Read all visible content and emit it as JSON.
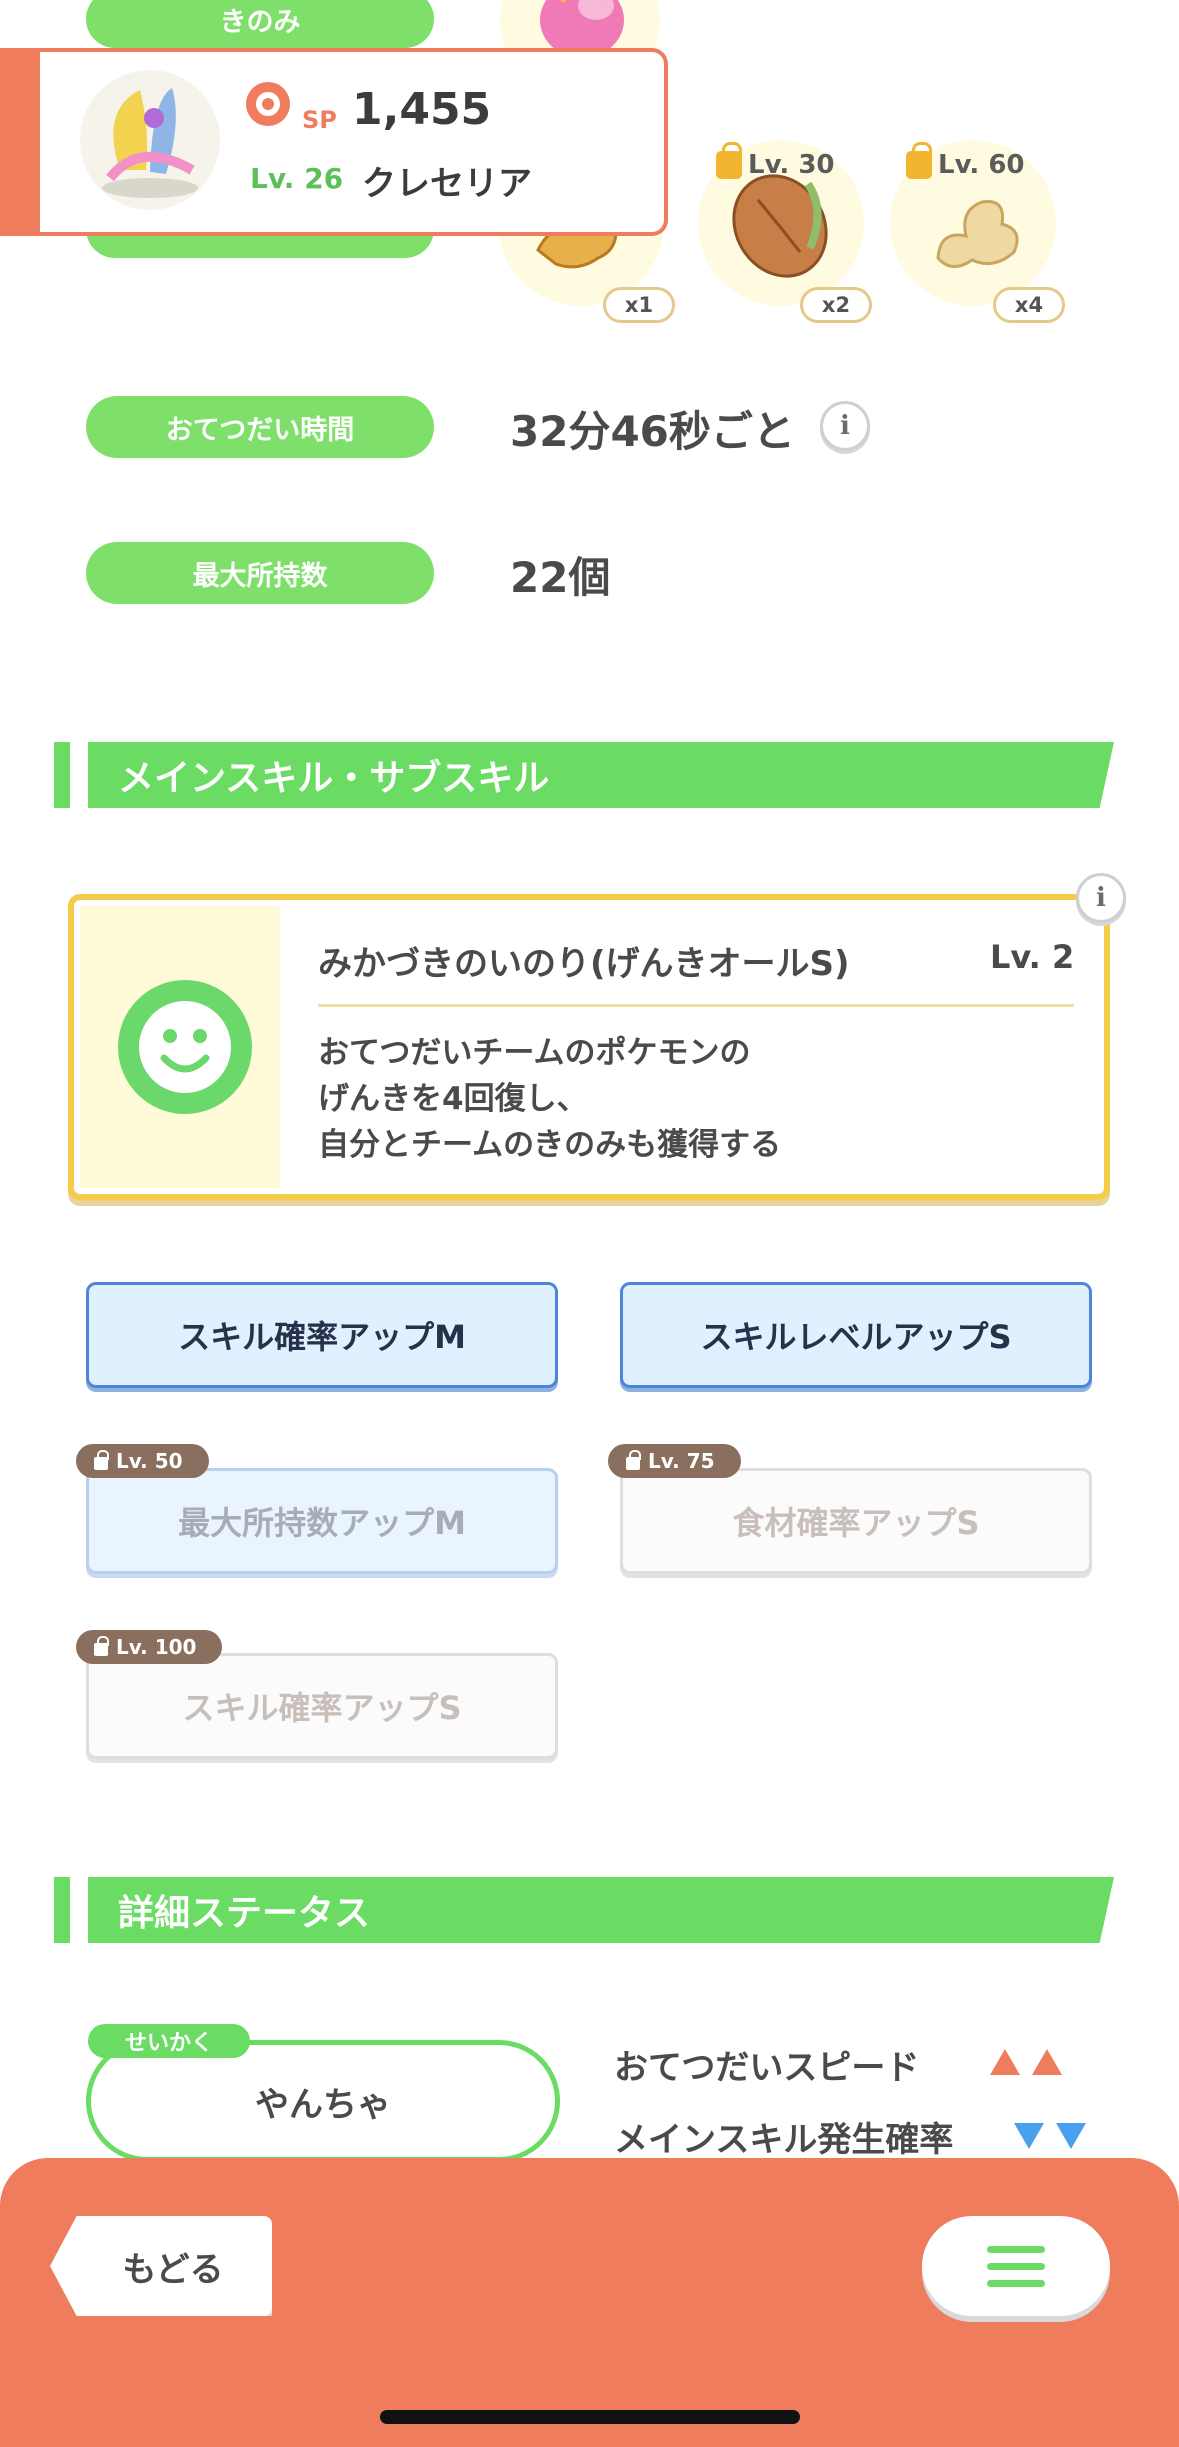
{
  "berry_section": {
    "label": "きのみ"
  },
  "pokemon": {
    "sp_label": "SP",
    "sp_value": "1,455",
    "level": "Lv. 26",
    "name": "クレセリア"
  },
  "ingredients": [
    {
      "name": "ginger-ingredient",
      "count": "x1",
      "unlock": ""
    },
    {
      "name": "cacao-ingredient",
      "count": "x2",
      "unlock": "Lv. 30"
    },
    {
      "name": "ginger-ingredient",
      "count": "x4",
      "unlock": "Lv. 60"
    }
  ],
  "stats": {
    "help_time_label": "おてつだい時間",
    "help_time_value": "32分46秒ごと",
    "max_carry_label": "最大所持数",
    "max_carry_value": "22個"
  },
  "skills_section": {
    "title": "メインスキル・サブスキル",
    "main_skill": {
      "name": "みかづきのいのり(げんきオールS)",
      "level": "Lv. 2",
      "description_lines": [
        "おてつだいチームのポケモンの",
        "げんきを4回復し、",
        "自分とチームのきのみも獲得する"
      ]
    },
    "sub_skills": [
      {
        "label": "スキル確率アップM",
        "unlock": ""
      },
      {
        "label": "スキルレベルアップS",
        "unlock": ""
      },
      {
        "label": "最大所持数アップM",
        "unlock": "Lv. 50"
      },
      {
        "label": "食材確率アップS",
        "unlock": "Lv. 75"
      },
      {
        "label": "スキル確率アップS",
        "unlock": "Lv. 100"
      }
    ]
  },
  "details_section": {
    "title": "詳細ステータス",
    "nature_tag": "せいかく",
    "nature_value": "やんちゃ",
    "effects": [
      {
        "label": "おてつだいスピード",
        "direction": "up"
      },
      {
        "label": "メインスキル発生確率",
        "direction": "down"
      }
    ]
  },
  "bottom_bar": {
    "back_label": "もどる",
    "menu_icon": "hamburger-menu-icon"
  },
  "colors": {
    "accent_green": "#6adc63",
    "accent_orange": "#ef7d5d",
    "skill_gold": "#f4cb4b",
    "sub_blue": "#4d86d8"
  }
}
